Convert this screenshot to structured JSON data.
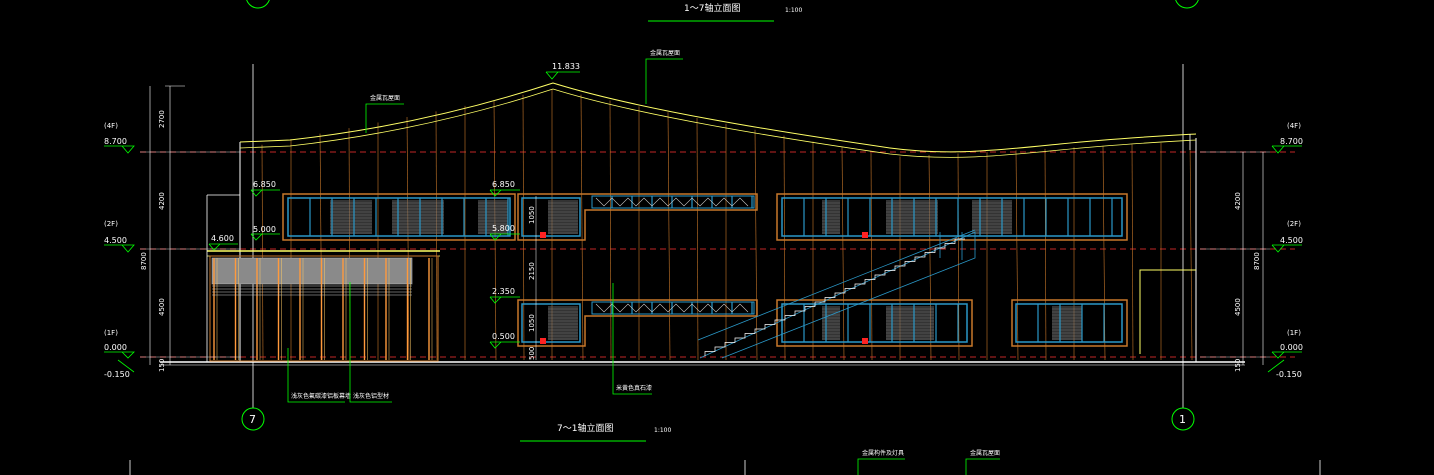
{
  "titles": {
    "top_title": "1～7轴立面图",
    "top_scale": "1:100",
    "main_title": "7～1轴立面图",
    "main_scale": "1:100"
  },
  "axes": {
    "left": "7",
    "right": "1"
  },
  "elevations_left": {
    "l3": {
      "tag": "(4F)",
      "value": "8.700"
    },
    "l2": {
      "tag": "(2F)",
      "value": "4.500"
    },
    "l1": {
      "tag": "(1F)",
      "value": "0.000"
    },
    "ground": "-0.150"
  },
  "elevations_right": {
    "l3": {
      "tag": "(4F)",
      "value": "8.700"
    },
    "l2": {
      "tag": "(2F)",
      "value": "4.500"
    },
    "l1": {
      "tag": "(1F)",
      "value": "0.000"
    },
    "ground": "-0.150"
  },
  "dims_left": {
    "d2700": "2700",
    "d4200": "4200",
    "d8700": "8700",
    "d4500": "4500",
    "d150": "150"
  },
  "dims_right": {
    "d4200": "4200",
    "d8700": "8700",
    "d4500": "4500",
    "d150": "150"
  },
  "level_marks": {
    "peak": "11.833",
    "m6850a": "6.850",
    "m5000": "5.000",
    "m4600": "4.600",
    "m6850b": "6.850",
    "m5800": "5.800",
    "m2350": "2.350",
    "m0500": "0.500"
  },
  "inner_dims": {
    "d1050a": "1050",
    "d2150": "2150",
    "d1050b": "1050",
    "d500": "500"
  },
  "annotations": {
    "roof_left": "金属瓦屋面",
    "roof_right": "金属瓦屋面",
    "panel_mid": "米黄色真石漆",
    "base_left_a": "浅灰色氟碳漆铝板幕墙",
    "base_left_b": "浅灰色铝型材",
    "bottom_a": "金属构件及灯具",
    "bottom_b": "金属瓦屋面"
  },
  "colors": {
    "background": "#000000",
    "outline": "#ffffff",
    "roof": "#ffff66",
    "panel": "#c8782a",
    "window": "#2a98c8",
    "leader": "#00ff00",
    "grid_red": "#ff3333",
    "hatch": "#6a6a6a"
  }
}
